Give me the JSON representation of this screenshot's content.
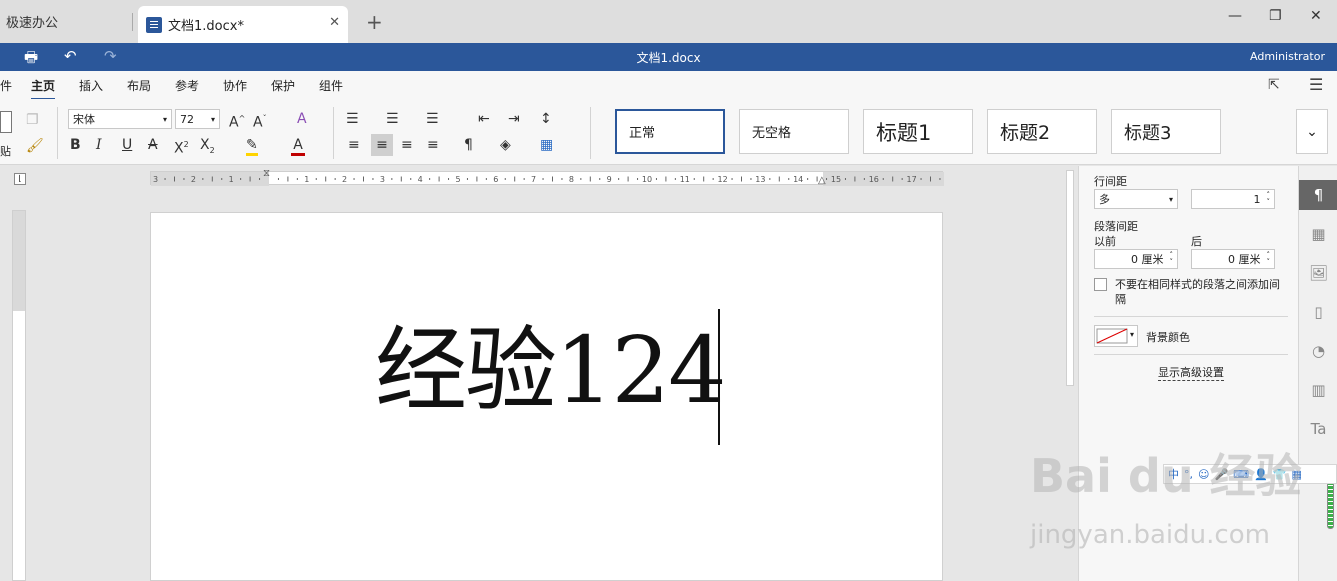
{
  "tabs": {
    "home_label": "极速办公",
    "doc_label": "文档1.docx*",
    "close_glyph": "✕",
    "add_glyph": "+"
  },
  "window": {
    "minimize": "—",
    "restore": "❐",
    "close": "✕"
  },
  "titlebar": {
    "title": "文档1.docx",
    "user": "Administrator"
  },
  "menu": {
    "items": [
      "件",
      "主页",
      "插入",
      "布局",
      "参考",
      "协作",
      "保护",
      "组件"
    ],
    "active": "主页"
  },
  "ribbon": {
    "paste_label": "贴",
    "font_name": "宋体",
    "font_size": "72",
    "styles": [
      "正常",
      "无空格",
      "标题1",
      "标题2",
      "标题3"
    ]
  },
  "document": {
    "text": "经验124"
  },
  "ruler_numbers": [
    "3",
    "2",
    "1",
    "1",
    "2",
    "3",
    "4",
    "5",
    "6",
    "7",
    "8",
    "9",
    "10",
    "11",
    "12",
    "13",
    "14",
    "15",
    "16",
    "17"
  ],
  "panel": {
    "line_spacing_label": "行间距",
    "line_spacing_type": "多",
    "line_spacing_value": "1",
    "para_spacing_label": "段落间距",
    "before_label": "以前",
    "after_label": "后",
    "before_value": "0 厘米",
    "after_value": "0 厘米",
    "checkbox_label": "不要在相同样式的段落之间添加间隔",
    "bg_color_label": "背景颜色",
    "advanced_link": "显示高级设置"
  },
  "ime": {
    "label": "中"
  },
  "watermark": {
    "brand": "Bai du 经验",
    "url": "jingyan.baidu.com"
  },
  "colors": {
    "accent": "#2b579a",
    "highlight": "#ffd400",
    "font_color": "#c00000"
  }
}
